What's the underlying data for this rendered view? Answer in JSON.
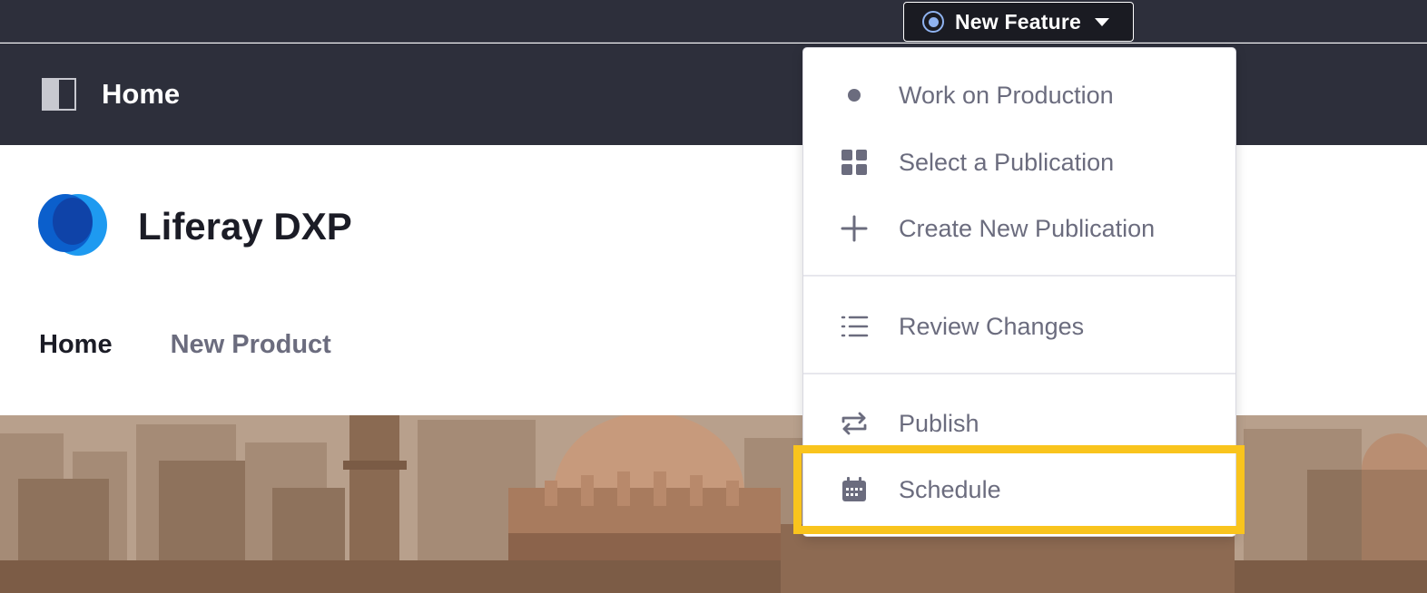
{
  "topbar": {
    "publication_label": "New Feature"
  },
  "control_menu": {
    "title": "Home"
  },
  "site": {
    "name": "Liferay DXP",
    "nav": [
      {
        "label": "Home"
      },
      {
        "label": "New Product"
      }
    ]
  },
  "dropdown": {
    "items": [
      {
        "label": "Work on Production",
        "icon": "dot-icon"
      },
      {
        "label": "Select a Publication",
        "icon": "grid-icon"
      },
      {
        "label": "Create New Publication",
        "icon": "plus-icon"
      },
      {
        "label": "Review Changes",
        "icon": "list-icon"
      },
      {
        "label": "Publish",
        "icon": "sync-icon"
      },
      {
        "label": "Schedule",
        "icon": "calendar-icon"
      }
    ]
  },
  "colors": {
    "topbar_bg": "#2d2f3b",
    "highlight": "#f9c41d",
    "logo_blue": "#0b5fff",
    "menu_text": "#6b6c7e"
  }
}
